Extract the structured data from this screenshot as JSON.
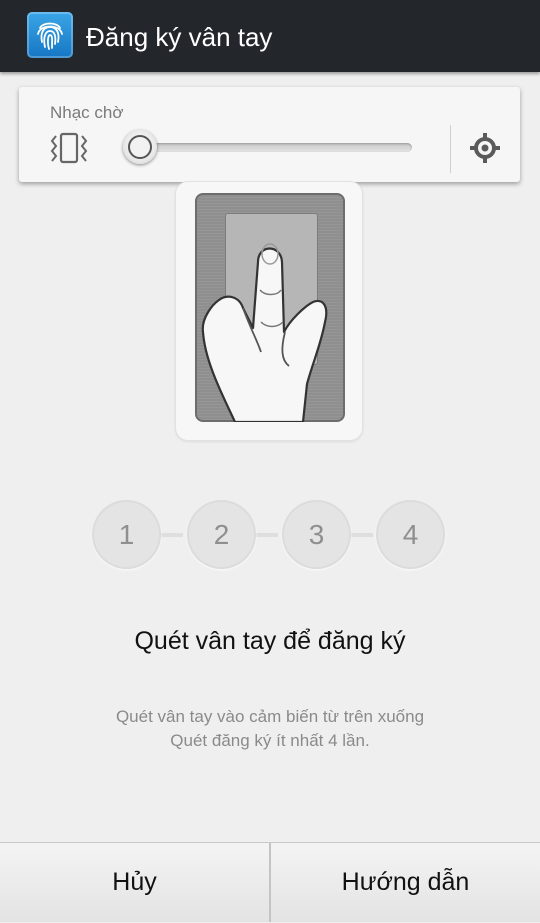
{
  "header": {
    "title": "Đăng ký vân tay",
    "icon": "fingerprint-icon"
  },
  "volume_panel": {
    "label": "Nhạc chờ",
    "mode_icon": "vibrate-icon",
    "level": 0,
    "settings_icon": "gear-icon"
  },
  "illustration": {
    "icon": "finger-swipe-icon"
  },
  "steps": [
    "1",
    "2",
    "3",
    "4"
  ],
  "instruction": {
    "title": "Quét vân tay để đăng ký",
    "line1": "Quét vân tay vào cảm biến từ trên xuống",
    "line2": "Quét đăng ký ít nhất 4 lần."
  },
  "buttons": {
    "cancel": "Hủy",
    "guide": "Hướng dẫn"
  },
  "colors": {
    "actionbar": "#23262b",
    "accent": "#1f8ad6"
  }
}
